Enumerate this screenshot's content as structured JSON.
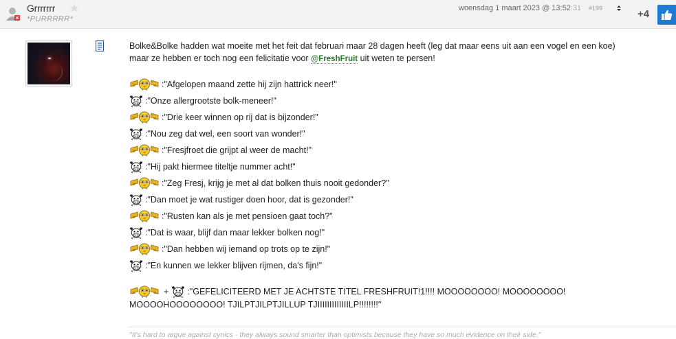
{
  "header": {
    "username": "Grrrrrrr",
    "usertitle": "*PURRRRR*",
    "date": "woensdag 1 maart 2023 @ 13:52",
    "seconds": ":31",
    "post_number": "#199",
    "score": "+4"
  },
  "post": {
    "intro_before": "Bolke&Bolke hadden wat moeite met het feit dat februari maar 28 dagen heeft (leg dat maar eens uit aan een vogel en een koe) maar ze hebben er toch nog een felicitatie voor ",
    "mention": "@FreshFruit",
    "intro_after": " uit weten te persen!",
    "lines": [
      {
        "speaker": "bird",
        "text": ":\"Afgelopen maand zette hij zijn hattrick neer!\""
      },
      {
        "speaker": "cow",
        "text": ":\"Onze allergrootste bolk-meneer!\""
      },
      {
        "speaker": "bird",
        "text": ":\"Drie keer winnen op rij dat is bijzonder!\""
      },
      {
        "speaker": "cow",
        "text": ":\"Nou zeg dat wel, een soort van wonder!\""
      },
      {
        "speaker": "bird",
        "text": ":\"Fresjfroet die grijpt al weer de macht!\""
      },
      {
        "speaker": "cow",
        "text": ":\"Hij pakt hiermee titeltje nummer acht!\""
      },
      {
        "speaker": "bird",
        "text": ":\"Zeg Fresj, krijg je met al dat bolken thuis nooit gedonder?\""
      },
      {
        "speaker": "cow",
        "text": ":\"Dan moet je wat rustiger doen hoor, dat is gezonder!\""
      },
      {
        "speaker": "bird",
        "text": ":\"Rusten kan als je met pensioen gaat toch?\""
      },
      {
        "speaker": "cow",
        "text": ":\"Dat is waar, blijf dan maar lekker bolken nog!\""
      },
      {
        "speaker": "bird",
        "text": ":\"Dan hebben wij iemand op trots op te zijn!\""
      },
      {
        "speaker": "cow",
        "text": ":\"En kunnen we lekker blijven rijmen, da's fijn!\""
      }
    ],
    "finale_plus": "+",
    "finale_line1": ":\"GEFELICITEERD MET JE ACHTSTE TITEL FRESHFRUIT!1!!!! MOOOOOOOO! MOOOOOOOO!",
    "finale_line2": "MOOOOHOOOOOOOO! TJILPTJILPTJILLUP TJIIIIIIIIIIIIILP!!!!!!!!\""
  },
  "signature": "\"It's hard to argue against cynics - they always sound smarter than optimists because they have so much evidence on their side.\"",
  "icons": {
    "user": "user-icon",
    "favorite": "star-icon",
    "sort": "sort-arrows-icon",
    "like": "thumbs-up-icon",
    "document": "document-icon",
    "bird_smiley": "bird-smiley-icon",
    "cow_smiley": "cow-smiley-icon"
  },
  "colors": {
    "like_button": "#1c7cd5",
    "mention": "#2a7a2a",
    "header_bg": "#f3f3f3"
  }
}
